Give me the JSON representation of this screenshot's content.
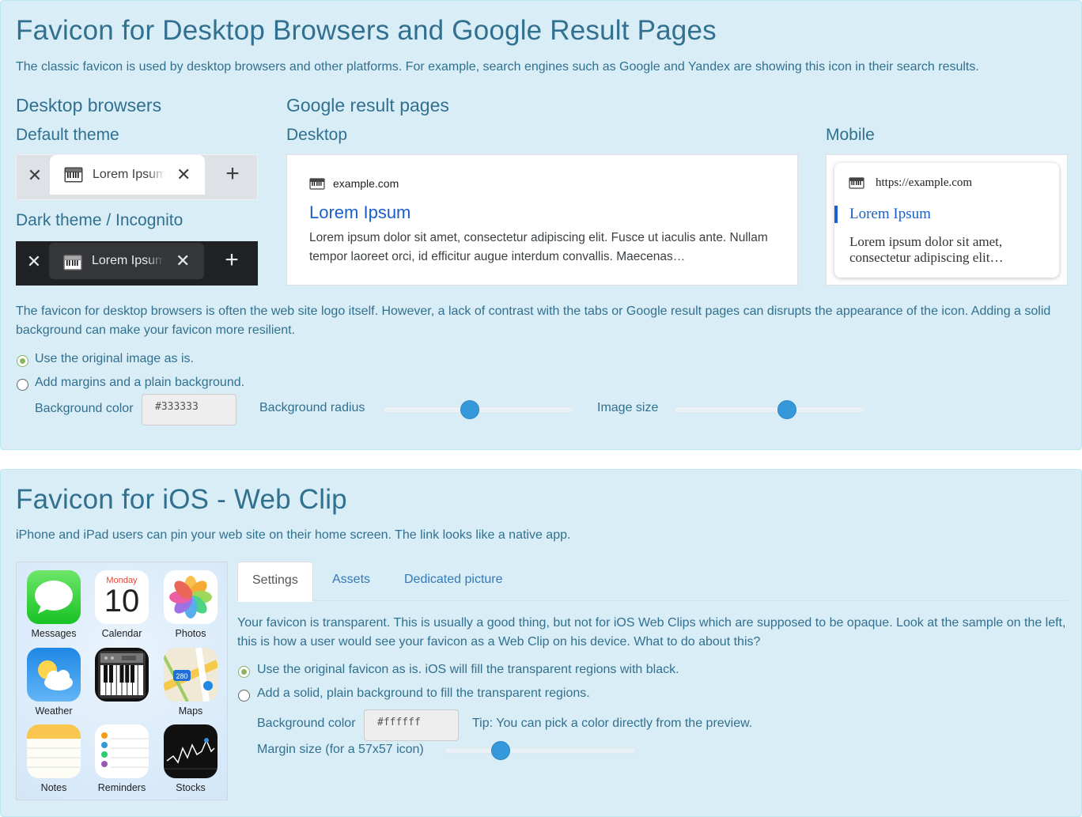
{
  "desktop_section": {
    "title": "Favicon for Desktop Browsers and Google Result Pages",
    "intro": "The classic favicon is used by desktop browsers and other platforms. For example, search engines such as Google and Yandex are showing this icon in their search results.",
    "desktop_browsers_heading": "Desktop browsers",
    "default_theme_label": "Default theme",
    "dark_theme_label": "Dark theme / Incognito",
    "tab_title": "Lorem Ipsum",
    "google_heading": "Google result pages",
    "desktop_label": "Desktop",
    "mobile_label": "Mobile",
    "google_desktop": {
      "site": "example.com",
      "title": "Lorem Ipsum",
      "snippet": "Lorem ipsum dolor sit amet, consectetur adipiscing elit. Fusce ut iaculis ante. Nullam tempor laoreet orci, id efficitur augue interdum convallis. Maecenas…"
    },
    "google_mobile": {
      "site": "https://example.com",
      "title": "Lorem Ipsum",
      "snippet": "Lorem ipsum dolor sit amet, consectetur adipiscing elit…"
    },
    "explanation": "The favicon for desktop browsers is often the web site logo itself. However, a lack of contrast with the tabs or Google result pages can disrupts the appearance of the icon. Adding a solid background can make your favicon more resilient.",
    "option_original": "Use the original image as is.",
    "option_margins": "Add margins and a plain background.",
    "bg_color_label": "Background color",
    "bg_color_value": "#333333",
    "bg_radius_label": "Background radius",
    "bg_radius_value": 0.45,
    "image_size_label": "Image size",
    "image_size_value": 0.6
  },
  "ios_section": {
    "title": "Favicon for iOS - Web Clip",
    "intro": "iPhone and iPad users can pin your web site on their home screen. The link looks like a native app.",
    "apps": [
      {
        "label": "Messages"
      },
      {
        "label": "Calendar",
        "day": "Monday",
        "date": "10"
      },
      {
        "label": "Photos"
      },
      {
        "label": "Weather"
      },
      {
        "label": ""
      },
      {
        "label": "Maps",
        "road": "280"
      },
      {
        "label": "Notes"
      },
      {
        "label": "Reminders"
      },
      {
        "label": "Stocks"
      }
    ],
    "tabs": [
      "Settings",
      "Assets",
      "Dedicated picture"
    ],
    "active_tab": "Settings",
    "description": "Your favicon is transparent. This is usually a good thing, but not for iOS Web Clips which are supposed to be opaque. Look at the sample on the left, this is how a user would see your favicon as a Web Clip on his device. What to do about this?",
    "option_original": "Use the original favicon as is. iOS will fill the transparent regions with black.",
    "option_solid": "Add a solid, plain background to fill the transparent regions.",
    "bg_color_label": "Background color",
    "bg_color_value": "#ffffff",
    "tip": "Tip: You can pick a color directly from the preview.",
    "margin_label": "Margin size (for a 57x57 icon)",
    "margin_value": 0.27
  },
  "colors": {
    "panel_bg": "#d9edf7",
    "text": "#31708f",
    "slider_thumb": "#3498db",
    "radio_on": "#8bb362"
  }
}
